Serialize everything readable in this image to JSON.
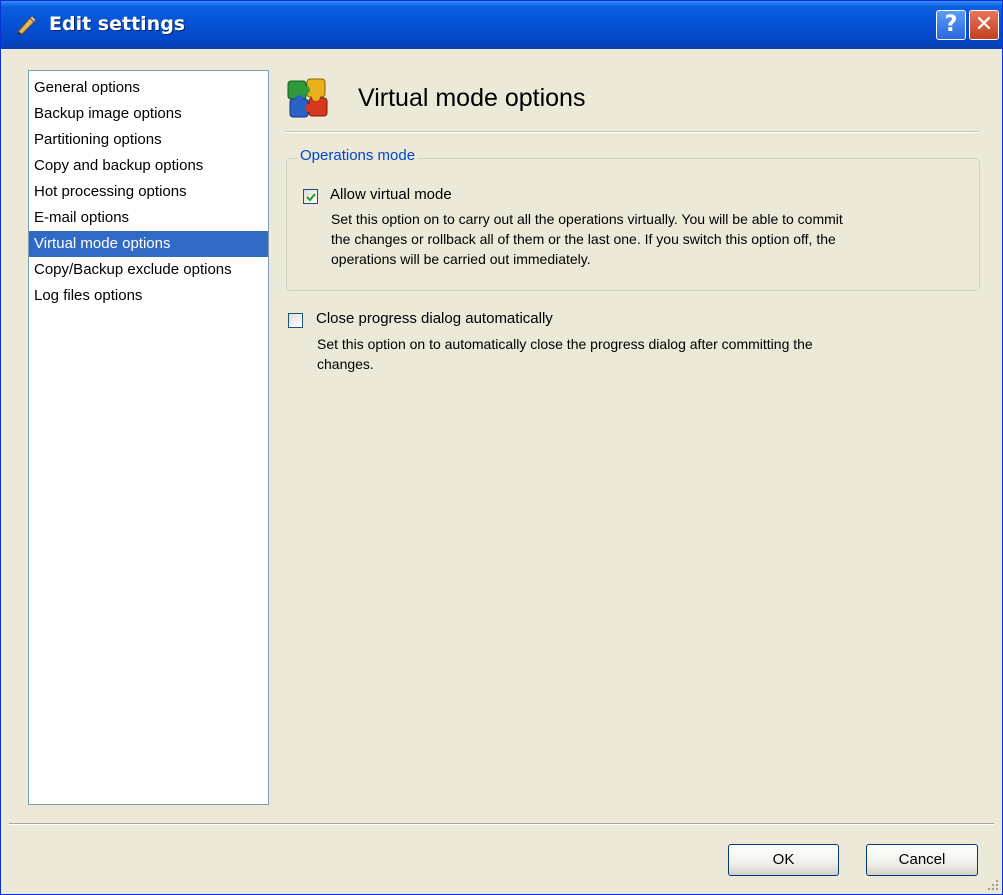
{
  "window": {
    "title": "Edit settings"
  },
  "titlebar": {
    "help_label": "?",
    "close_label": "✕"
  },
  "sidebar": {
    "items": [
      {
        "label": "General options"
      },
      {
        "label": "Backup image options"
      },
      {
        "label": "Partitioning options"
      },
      {
        "label": "Copy and backup options"
      },
      {
        "label": "Hot processing options"
      },
      {
        "label": "E-mail options"
      },
      {
        "label": "Virtual mode options",
        "selected": true
      },
      {
        "label": "Copy/Backup exclude options"
      },
      {
        "label": "Log files options"
      }
    ]
  },
  "page": {
    "title": "Virtual mode options",
    "group_title": "Operations mode",
    "options": [
      {
        "label": "Allow virtual mode",
        "checked": true,
        "desc_lines": [
          "Set this option on to carry out all the operations virtually. You will be able to commit",
          "the changes or rollback all of them or the last one. If you switch this option off, the",
          "operations will be carried out immediately."
        ]
      },
      {
        "label": "Close progress dialog automatically",
        "checked": false,
        "desc_lines": [
          "Set this option on to automatically close the progress dialog after committing the",
          "changes."
        ]
      }
    ]
  },
  "footer": {
    "ok_label": "OK",
    "cancel_label": "Cancel"
  },
  "colors": {
    "titlebar": "#0552d6",
    "selection": "#316ac5",
    "dialog_bg": "#ece9d8",
    "group_title": "#0046d5"
  }
}
